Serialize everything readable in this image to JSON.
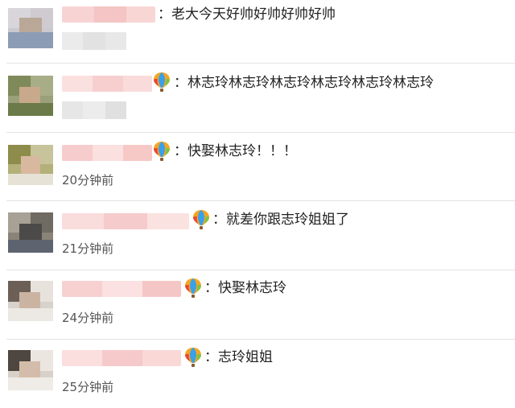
{
  "comments": [
    {
      "text": "：老大今天好帅好帅好帅好帅",
      "time": "",
      "time_blurred": true,
      "badge": false
    },
    {
      "text": "：林志玲林志玲林志玲林志玲林志玲林志玲",
      "time": "",
      "time_blurred": true,
      "badge": true
    },
    {
      "text": "：快娶林志玲！！！",
      "time": "20分钟前",
      "time_blurred": false,
      "badge": true
    },
    {
      "text": "：就差你跟志玲姐姐了",
      "time": "21分钟前",
      "time_blurred": false,
      "badge": true
    },
    {
      "text": "：快娶林志玲",
      "time": "24分钟前",
      "time_blurred": false,
      "badge": true
    },
    {
      "text": "：志玲姐姐",
      "time": "25分钟前",
      "time_blurred": false,
      "badge": true
    }
  ],
  "badge_icon": "hot-air-balloon-icon",
  "colors": {
    "username_blur": "#f6c9c9",
    "text": "#222222",
    "time": "#555555",
    "divider": "#e3e3e3"
  }
}
